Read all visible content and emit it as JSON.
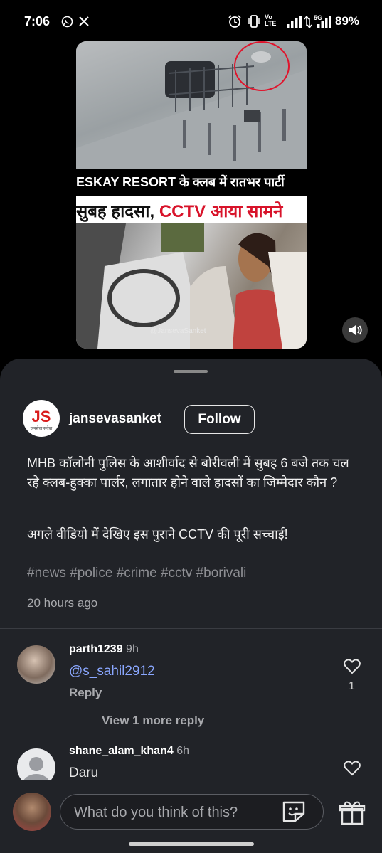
{
  "status_bar": {
    "time": "7:06",
    "left_icons": [
      "whatsapp-icon",
      "x-icon"
    ],
    "right_icons": [
      "alarm-icon",
      "vibrate-icon",
      "volte-icon",
      "signal-icon",
      "5g-signal-icon"
    ],
    "network_label": "5G",
    "volte_label": "Vo LTE",
    "battery": "89%"
  },
  "video": {
    "caption_line1": "ESKAY RESORT के क्लब में रातभर पार्टी",
    "caption_line2_a": "सुबह हादसा, ",
    "caption_line2_b": "CCTV आया सामने",
    "watermark": "@JansevaSanket",
    "sound_icon": "speaker-icon"
  },
  "post": {
    "username": "jansevasanket",
    "logo_text": "JS",
    "logo_subtext": "जनसेवा संकेत",
    "follow_label": "Follow",
    "caption_p1": "MHB कॉलोनी पुलिस के आशीर्वाद से बोरीवली में सुबह 6 बजे तक चल रहे क्लब-हुक्का पार्लर, लगातार होने वाले हादसों का जिम्मेदार कौन ?",
    "caption_p2": "अगले वीडियो में देखिए इस पुराने CCTV की पूरी सच्चाई!",
    "hashtags": "#news #police #crime #cctv #borivali",
    "posted_ago": "20 hours ago"
  },
  "comments": [
    {
      "username": "parth1239",
      "time": "9h",
      "text": "@s_sahil2912",
      "reply_label": "Reply",
      "likes": "1",
      "view_more": "View 1 more reply"
    },
    {
      "username": "shane_alam_khan4",
      "time": "6h",
      "text": "Daru"
    }
  ],
  "composer": {
    "placeholder": "What do you think of this?"
  },
  "colors": {
    "sheet_bg": "#212328",
    "mention": "#8aa7ff",
    "caption_red": "#d8132a"
  }
}
